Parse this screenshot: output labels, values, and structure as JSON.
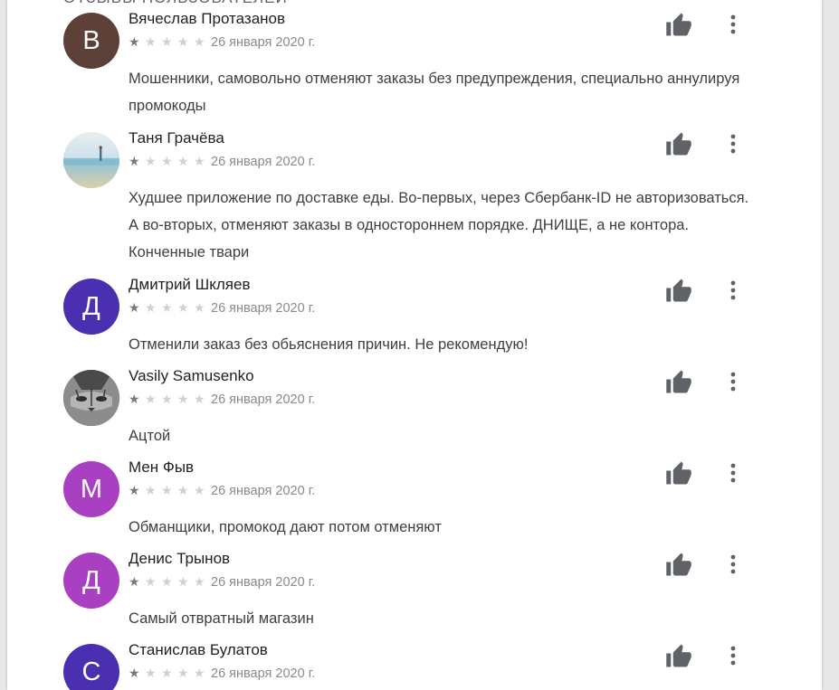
{
  "section": {
    "title": "Отзывы пользователей"
  },
  "colors": {
    "star_on": "#7a7a7a",
    "star_off": "#d0d0d0",
    "icon": "#5f6368"
  },
  "icons": {
    "like": "thumb-up-icon",
    "menu": "more-vert-icon"
  },
  "reviews": [
    {
      "author": "Вячеслав Протазанов",
      "initial": "В",
      "avatar_color": "#5d4037",
      "avatar_type": "letter",
      "rating": 1,
      "date": "26 января 2020 г.",
      "text": "Мошенники, самовольно отменяют заказы без предупреждения, специально аннулируя промокоды"
    },
    {
      "author": "Таня Грачёва",
      "initial": "",
      "avatar_color": "#bcd6e6",
      "avatar_type": "photo-beach",
      "rating": 1,
      "date": "26 января 2020 г.",
      "text": "Худшее приложение по доставке еды. Во-первых, через Сбербанк-ID не авторизоваться. А во-вторых, отменяют заказы в одностороннем порядке. ДНИЩЕ, а не контора. Конченные твари"
    },
    {
      "author": "Дмитрий Шкляев",
      "initial": "Д",
      "avatar_color": "#4a2fb0",
      "avatar_type": "letter",
      "rating": 1,
      "date": "26 января 2020 г.",
      "text": "Отменили заказ без обьяснения причин. Не рекомендую!"
    },
    {
      "author": "Vasily Samusenko",
      "initial": "",
      "avatar_color": "#6a6a6a",
      "avatar_type": "photo-cat",
      "rating": 1,
      "date": "26 января 2020 г.",
      "text": "Ацтой"
    },
    {
      "author": "Мен Фыв",
      "initial": "М",
      "avatar_color": "#a93fc1",
      "avatar_type": "letter",
      "rating": 1,
      "date": "26 января 2020 г.",
      "text": "Обманщики, промокод дают потом отменяют"
    },
    {
      "author": "Денис Трынов",
      "initial": "Д",
      "avatar_color": "#a93fc1",
      "avatar_type": "letter",
      "rating": 1,
      "date": "26 января 2020 г.",
      "text": "Самый отвратный магазин"
    },
    {
      "author": "Станислав Булатов",
      "initial": "С",
      "avatar_color": "#4a2fb0",
      "avatar_type": "letter",
      "rating": 1,
      "date": "26 января 2020 г.",
      "text": ""
    }
  ]
}
